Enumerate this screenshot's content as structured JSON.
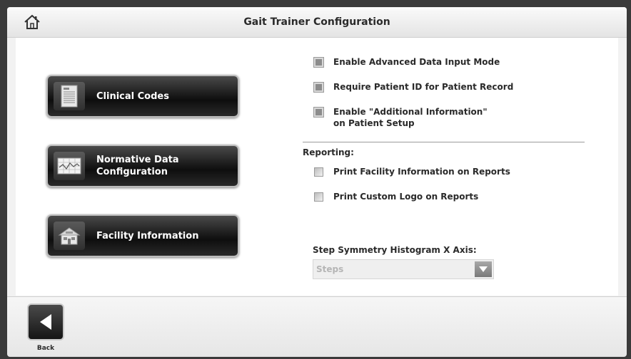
{
  "window": {
    "title": "Gait Trainer Configuration",
    "home_icon": "home-icon"
  },
  "left_buttons": [
    {
      "label": "Clinical Codes",
      "icon": "document-icon"
    },
    {
      "label": "Normative Data\nConfiguration",
      "icon": "chart-grid-icon"
    },
    {
      "label": "Facility Information",
      "icon": "building-icon"
    }
  ],
  "options": {
    "advanced_input": {
      "label": "Enable Advanced Data Input Mode",
      "checked": false
    },
    "require_patient_id": {
      "label": "Require Patient ID for Patient Record",
      "checked": false
    },
    "additional_info": {
      "label": "Enable \"Additional Information\"\non Patient Setup",
      "checked": false
    }
  },
  "reporting": {
    "heading": "Reporting:",
    "print_facility": {
      "label": "Print Facility Information on Reports",
      "checked": false
    },
    "print_logo": {
      "label": "Print Custom Logo on Reports",
      "checked": false
    }
  },
  "histogram": {
    "label": "Step Symmetry Histogram X Axis:",
    "selected": "Steps"
  },
  "footer": {
    "back_label": "Back"
  },
  "colors": {
    "background": "#3a3a3a",
    "panel": "#ffffff",
    "button_dark": "#1c1c1c",
    "text": "#2a2a2a"
  }
}
